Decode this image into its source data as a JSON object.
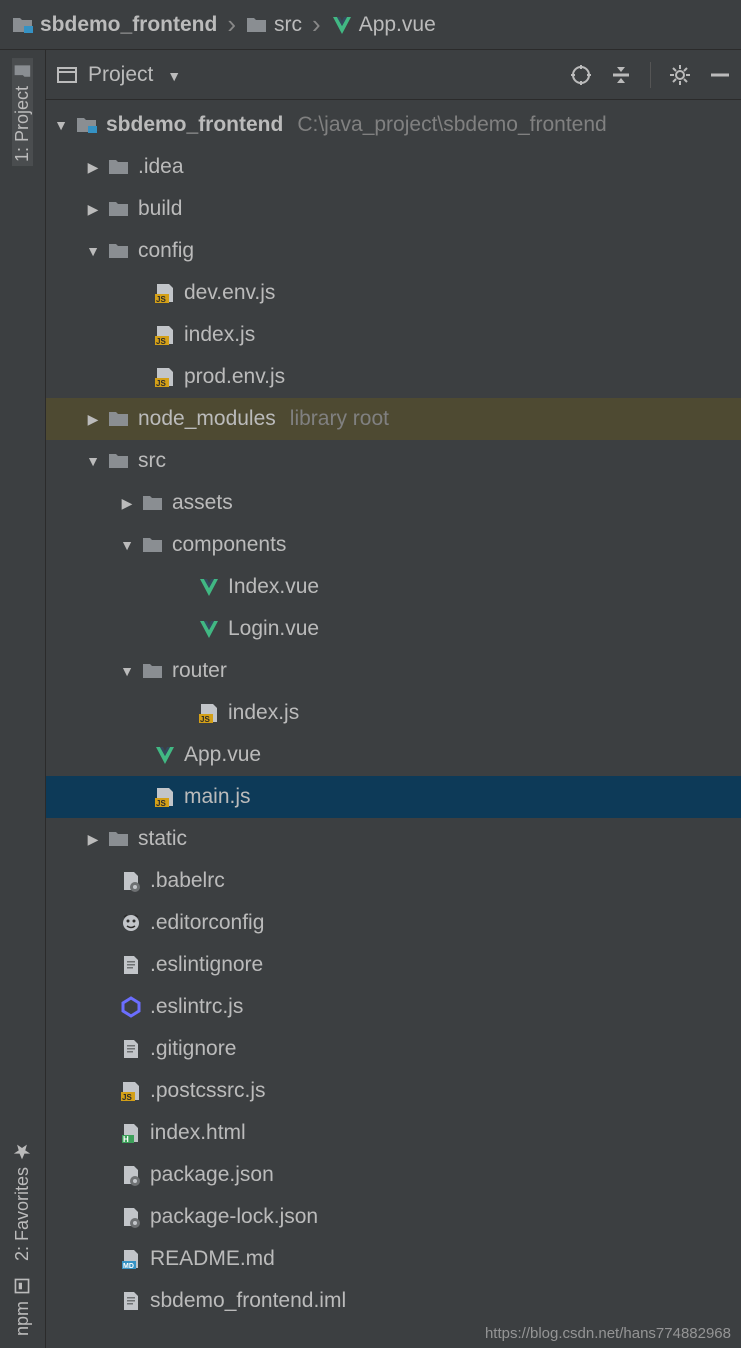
{
  "breadcrumb": {
    "project": "sbdemo_frontend",
    "folder": "src",
    "file": "App.vue"
  },
  "gutter": {
    "project_label": "1: Project",
    "favorites_label": "2: Favorites",
    "npm_label": "npm"
  },
  "toolbar": {
    "title": "Project"
  },
  "tree": {
    "root_name": "sbdemo_frontend",
    "root_path": "C:\\java_project\\sbdemo_frontend",
    "idea": ".idea",
    "build": "build",
    "config": "config",
    "dev_env": "dev.env.js",
    "index_js": "index.js",
    "prod_env": "prod.env.js",
    "node_modules": "node_modules",
    "node_modules_hint": "library root",
    "src": "src",
    "assets": "assets",
    "components": "components",
    "index_vue": "Index.vue",
    "login_vue": "Login.vue",
    "router": "router",
    "router_index": "index.js",
    "app_vue": "App.vue",
    "main_js": "main.js",
    "static": "static",
    "babelrc": ".babelrc",
    "editorconfig": ".editorconfig",
    "eslintignore": ".eslintignore",
    "eslintrc": ".eslintrc.js",
    "gitignore": ".gitignore",
    "postcssrc": ".postcssrc.js",
    "index_html": "index.html",
    "package_json": "package.json",
    "package_lock": "package-lock.json",
    "readme": "README.md",
    "iml": "sbdemo_frontend.iml"
  },
  "watermark": "https://blog.csdn.net/hans774882968"
}
